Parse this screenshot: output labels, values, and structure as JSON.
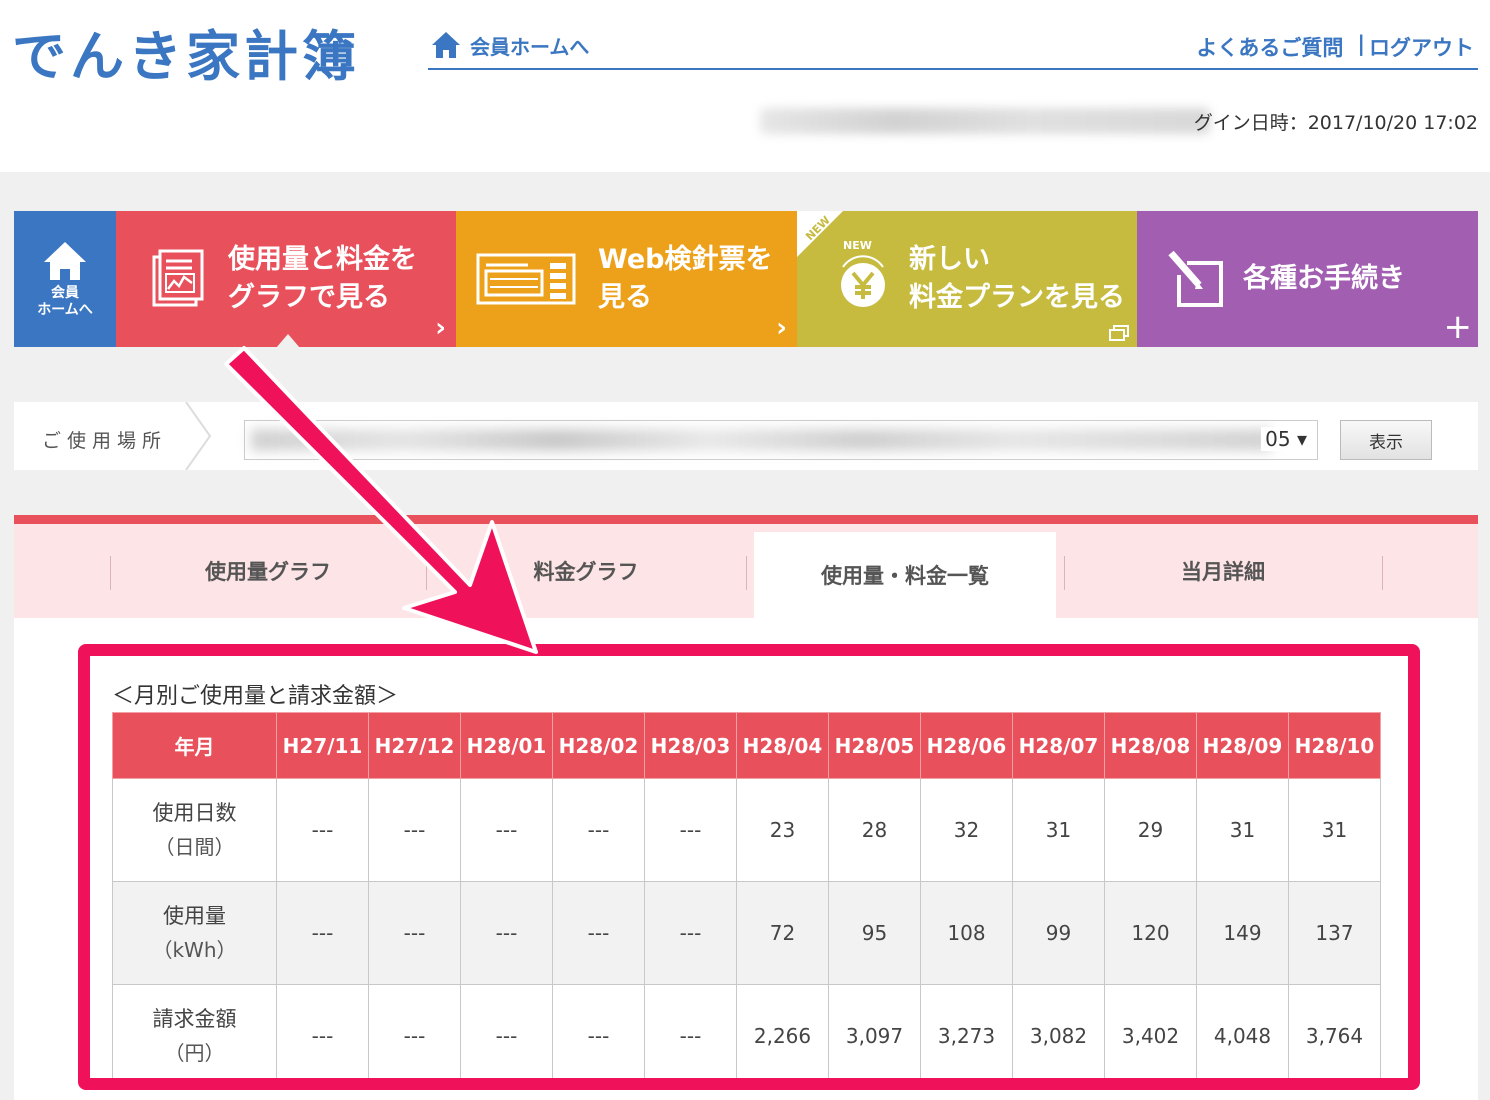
{
  "header": {
    "logo": "でんき家計簿",
    "home_link": "会員ホームへ",
    "faq": "よくあるご質問",
    "separator": "|",
    "logout": "ログアウト",
    "login_time": "グイン日時：2017/10/20 17:02"
  },
  "nav": {
    "home_label": "会員\nホームへ",
    "graph": "使用量と料金を\nグラフで見る",
    "web": "Web検針票を\n見る",
    "new_badge": "NEW",
    "plan_badge": "NEW",
    "plan": "新しい\n料金プランを見る",
    "procedures": "各種お手続き",
    "chevron": "›",
    "plus": "+"
  },
  "location": {
    "label": "ご使用場所",
    "visible_suffix": "05 ▾",
    "show_button": "表示"
  },
  "tabs": [
    {
      "label": "使用量グラフ"
    },
    {
      "label": "料金グラフ"
    },
    {
      "label": "使用量・料金一覧"
    },
    {
      "label": "当月詳細"
    }
  ],
  "table": {
    "title": "＜月別ご使用量と請求金額＞",
    "header_label": "年月",
    "months": [
      "H27/11",
      "H27/12",
      "H28/01",
      "H28/02",
      "H28/03",
      "H28/04",
      "H28/05",
      "H28/06",
      "H28/07",
      "H28/08",
      "H28/09",
      "H28/10"
    ],
    "rows": [
      {
        "label": "使用日数",
        "unit": "（日間）",
        "values": [
          "---",
          "---",
          "---",
          "---",
          "---",
          "23",
          "28",
          "32",
          "31",
          "29",
          "31",
          "31"
        ]
      },
      {
        "label": "使用量",
        "unit": "（kWh）",
        "values": [
          "---",
          "---",
          "---",
          "---",
          "---",
          "72",
          "95",
          "108",
          "99",
          "120",
          "149",
          "137"
        ]
      },
      {
        "label": "請求金額",
        "unit": "（円）",
        "values": [
          "---",
          "---",
          "---",
          "---",
          "---",
          "2,266",
          "3,097",
          "3,273",
          "3,082",
          "3,402",
          "4,048",
          "3,764"
        ]
      }
    ]
  },
  "colors": {
    "brand_blue": "#3a76c1",
    "graph_red": "#e8505b",
    "web_orange": "#eda11b",
    "plan_olive": "#c6bb3f",
    "proc_purple": "#a25fb1",
    "highlight_pink": "#f0115b"
  }
}
